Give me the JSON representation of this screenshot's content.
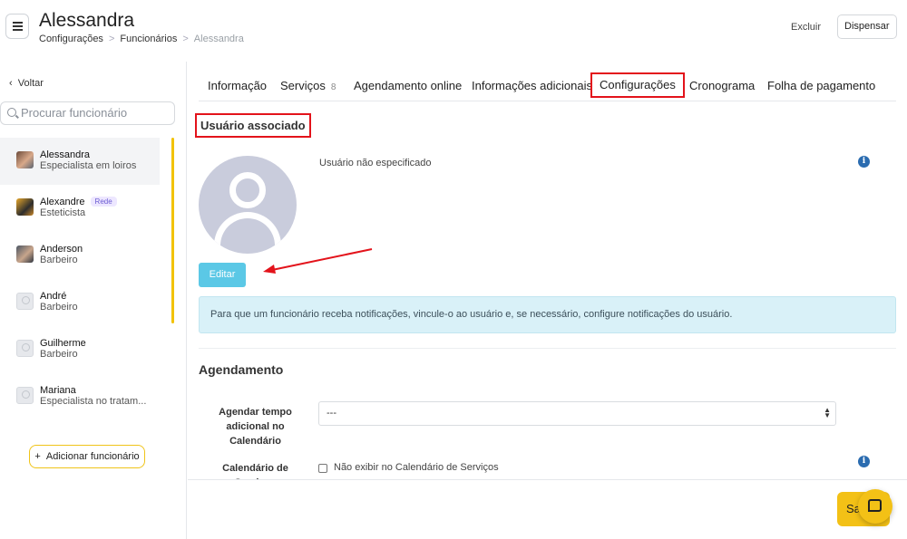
{
  "header": {
    "title": "Alessandra",
    "breadcrumb": [
      "Configurações",
      "Funcionários",
      "Alessandra"
    ],
    "delete_label": "Excluir",
    "dismiss_label": "Dispensar"
  },
  "sidebar": {
    "back_label": "Voltar",
    "search_placeholder": "Procurar funcionário",
    "employees": [
      {
        "name": "Alessandra",
        "role": "Especialista em loiros",
        "badge": ""
      },
      {
        "name": "Alexandre",
        "role": "Esteticista",
        "badge": "Rede"
      },
      {
        "name": "Anderson",
        "role": "Barbeiro",
        "badge": ""
      },
      {
        "name": "André",
        "role": "Barbeiro",
        "badge": ""
      },
      {
        "name": "Guilherme",
        "role": "Barbeiro",
        "badge": ""
      },
      {
        "name": "Mariana",
        "role": "Especialista no tratam...",
        "badge": ""
      }
    ],
    "add_label": "Adicionar funcionário"
  },
  "tabs": [
    {
      "label": "Informação"
    },
    {
      "label": "Serviços",
      "count": "8"
    },
    {
      "label": "Agendamento online"
    },
    {
      "label": "Informações adicionais"
    },
    {
      "label": "Configurações",
      "active": true
    },
    {
      "label": "Cronograma"
    },
    {
      "label": "Folha de pagamento"
    }
  ],
  "user_section": {
    "title": "Usuário associado",
    "status": "Usuário não especificado",
    "edit_label": "Editar",
    "alert": "Para que um funcionário receba notificações, vincule-o ao usuário e, se necessário, configure notificações do usuário."
  },
  "scheduling": {
    "title": "Agendamento",
    "extra_time_label": "Agendar tempo adicional no Calendário",
    "extra_time_value": "---",
    "calendar_label": "Calendário de Serviços",
    "calendar_checkbox": "Não exibir no Calendário de Serviços"
  },
  "footer": {
    "save_label": "Sa"
  },
  "colors": {
    "accent": "#f3c116",
    "highlight": "#e3131b",
    "info": "#5bc8e6"
  }
}
